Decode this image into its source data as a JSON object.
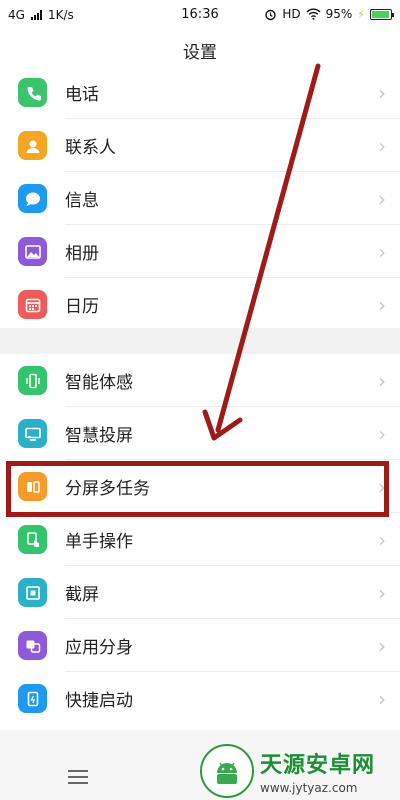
{
  "status_bar": {
    "network": "4G",
    "speed": "1K/s",
    "time": "16:36",
    "hd": "HD",
    "battery": "95%",
    "battery_level": 0.95
  },
  "header": {
    "title": "设置"
  },
  "group1": [
    {
      "label": "电话",
      "icon": "phone-icon",
      "color": "#3cc46b"
    },
    {
      "label": "联系人",
      "icon": "contacts-icon",
      "color": "#f5a623"
    },
    {
      "label": "信息",
      "icon": "message-icon",
      "color": "#1e9bf0"
    },
    {
      "label": "相册",
      "icon": "album-icon",
      "color": "#8e5bd8"
    },
    {
      "label": "日历",
      "icon": "calendar-icon",
      "color": "#ef5b5b"
    }
  ],
  "group2": [
    {
      "label": "智能体感",
      "icon": "motion-icon",
      "color": "#35c46e"
    },
    {
      "label": "智慧投屏",
      "icon": "screencast-icon",
      "color": "#2bb0c8"
    },
    {
      "label": "分屏多任务",
      "icon": "split-screen-icon",
      "color": "#f59b2a"
    },
    {
      "label": "单手操作",
      "icon": "one-hand-icon",
      "color": "#35c46e"
    },
    {
      "label": "截屏",
      "icon": "screenshot-icon",
      "color": "#2bb0c8"
    },
    {
      "label": "应用分身",
      "icon": "app-clone-icon",
      "color": "#8e5bd8"
    },
    {
      "label": "快捷启动",
      "icon": "quick-launch-icon",
      "color": "#1e9bf0"
    }
  ],
  "chevron": "›",
  "watermark": {
    "title": "天源安卓网",
    "url": "www.jytyaz.com"
  },
  "colors": {
    "highlight": "#a11a1a",
    "arrow": "#a11a1a"
  }
}
